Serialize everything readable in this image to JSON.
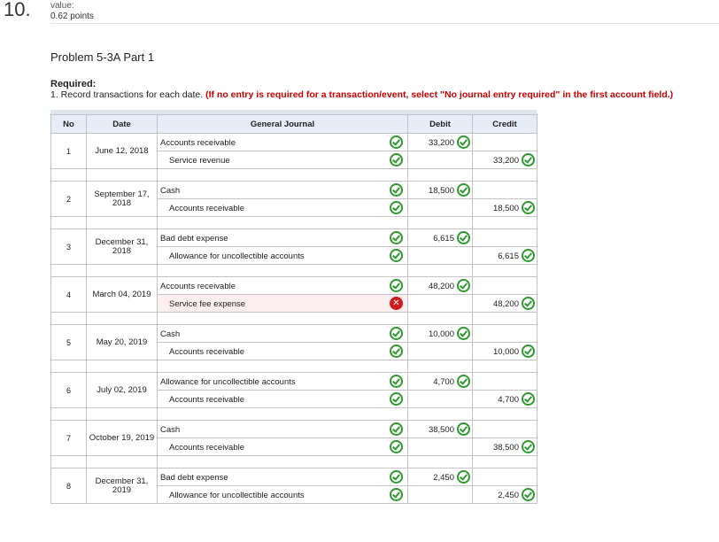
{
  "question": {
    "number": "10.",
    "value_label": "value:",
    "points": "0.62 points"
  },
  "problem_title": "Problem 5-3A Part 1",
  "required": {
    "label": "Required:",
    "instruction": "1. Record transactions for each date.",
    "warning": "(If no entry is required for a transaction/event, select \"No journal entry required\" in the first account field.)"
  },
  "table": {
    "headers": {
      "no": "No",
      "date": "Date",
      "general_journal": "General Journal",
      "debit": "Debit",
      "credit": "Credit"
    },
    "entries": [
      {
        "no": "1",
        "date": "June 12, 2018",
        "debit_account": "Accounts receivable",
        "debit_status": "correct",
        "debit_amount": "33,200",
        "credit_account": "Service revenue",
        "credit_status": "correct",
        "credit_amount": "33,200"
      },
      {
        "no": "2",
        "date": "September 17, 2018",
        "debit_account": "Cash",
        "debit_status": "correct",
        "debit_amount": "18,500",
        "credit_account": "Accounts receivable",
        "credit_status": "correct",
        "credit_amount": "18,500"
      },
      {
        "no": "3",
        "date": "December 31, 2018",
        "debit_account": "Bad debt expense",
        "debit_status": "correct",
        "debit_amount": "6,615",
        "credit_account": "Allowance for uncollectible accounts",
        "credit_status": "correct",
        "credit_amount": "6,615"
      },
      {
        "no": "4",
        "date": "March 04, 2019",
        "debit_account": "Accounts receivable",
        "debit_status": "correct",
        "debit_amount": "48,200",
        "credit_account": "Service fee expense",
        "credit_status": "incorrect",
        "credit_amount": "48,200"
      },
      {
        "no": "5",
        "date": "May 20, 2019",
        "debit_account": "Cash",
        "debit_status": "correct",
        "debit_amount": "10,000",
        "credit_account": "Accounts receivable",
        "credit_status": "correct",
        "credit_amount": "10,000"
      },
      {
        "no": "6",
        "date": "July 02, 2019",
        "debit_account": "Allowance for uncollectible accounts",
        "debit_status": "correct",
        "debit_amount": "4,700",
        "credit_account": "Accounts receivable",
        "credit_status": "correct",
        "credit_amount": "4,700"
      },
      {
        "no": "7",
        "date": "October 19, 2019",
        "debit_account": "Cash",
        "debit_status": "correct",
        "debit_amount": "38,500",
        "credit_account": "Accounts receivable",
        "credit_status": "correct",
        "credit_amount": "38,500"
      },
      {
        "no": "8",
        "date": "December 31, 2019",
        "debit_account": "Bad debt expense",
        "debit_status": "correct",
        "debit_amount": "2,450",
        "credit_account": "Allowance for uncollectible accounts",
        "credit_status": "correct",
        "credit_amount": "2,450"
      }
    ]
  },
  "colors": {
    "correct": "#2f9a2f",
    "incorrect": "#d11b1b",
    "warning_text": "#cc0000",
    "header_bg": "#e5edf7"
  },
  "icons": {
    "correct": "check-circle-icon",
    "incorrect": "x-circle-icon"
  }
}
